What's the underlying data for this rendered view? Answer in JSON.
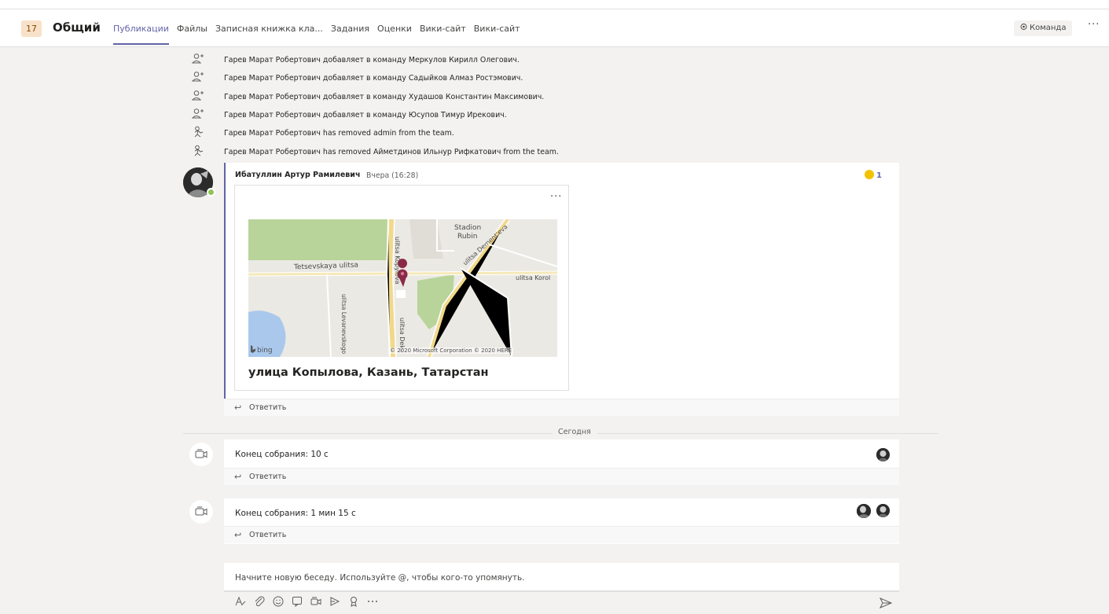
{
  "header": {
    "team_badge": "17",
    "channel_name": "Общий",
    "tabs": [
      {
        "label": "Публикации",
        "active": true
      },
      {
        "label": "Файлы",
        "active": false
      },
      {
        "label": "Записная книжка кла...",
        "active": false
      },
      {
        "label": "Задания",
        "active": false
      },
      {
        "label": "Оценки",
        "active": false
      },
      {
        "label": "Вики-сайт",
        "active": false
      },
      {
        "label": "Вики-сайт",
        "active": false
      }
    ],
    "team_button": "Команда",
    "more": "···"
  },
  "activity": [
    {
      "actor": "Гарев Марат Робертович",
      "action": " добавляет в команду ",
      "target": "Меркулов Кирилл Олегович",
      "tail": ".",
      "icon": "add-person-icon"
    },
    {
      "actor": "Гарев Марат Робертович",
      "action": " добавляет в команду ",
      "target": "Садыйков Алмаз Ростэмович",
      "tail": ".",
      "icon": "add-person-icon"
    },
    {
      "actor": "Гарев Марат Робертович",
      "action": " добавляет в команду ",
      "target": "Худашов Константин Максимович",
      "tail": ".",
      "icon": "add-person-icon"
    },
    {
      "actor": "Гарев Марат Робертович",
      "action": " добавляет в команду ",
      "target": "Юсупов Тимур Ирекович",
      "tail": ".",
      "icon": "add-person-icon"
    },
    {
      "actor": "Гарев Марат Робертович",
      "action": " has removed ",
      "target": "admin",
      "tail": " from the team.",
      "icon": "remove-person-icon"
    },
    {
      "actor": "Гарев Марат Робертович",
      "action": " has removed ",
      "target": "Айметдинов Ильнур Рифкатович",
      "tail": " from the team.",
      "icon": "remove-person-icon"
    }
  ],
  "post": {
    "author": "Ибатуллин Артур Рамилевич",
    "time": "Вчера (16:28)",
    "reaction_count": "1",
    "card_more": "···",
    "map": {
      "labels": {
        "stadium": "Stadion",
        "stadium2": "Rubin",
        "street1": "Tetsevskaya ulitsa",
        "street2": "ulitsa Kopylova",
        "street3": "ulitsa Dement'eva",
        "street4": "ulitsa Korol",
        "street5": "ulitsa Levanevskogo",
        "street6": "ulitsa Deko",
        "bing": "bing",
        "copyright": "© 2020 Microsoft Corporation © 2020 HERE"
      }
    },
    "location_title": "улица Копылова,  Казань,  Татарстан",
    "reply": "Ответить"
  },
  "today_label": "Сегодня",
  "meetings": [
    {
      "title": "Конец собрания: 10 с",
      "reply": "Ответить"
    },
    {
      "title": "Конец собрания: 1 мин 15 с",
      "reply": "Ответить"
    }
  ],
  "compose": {
    "placeholder": "Начните новую беседу. Используйте @, чтобы кого-то упомянуть."
  },
  "colors": {
    "accent": "#6264a7",
    "presence": "#92c353",
    "reaction": "#f2c200"
  }
}
